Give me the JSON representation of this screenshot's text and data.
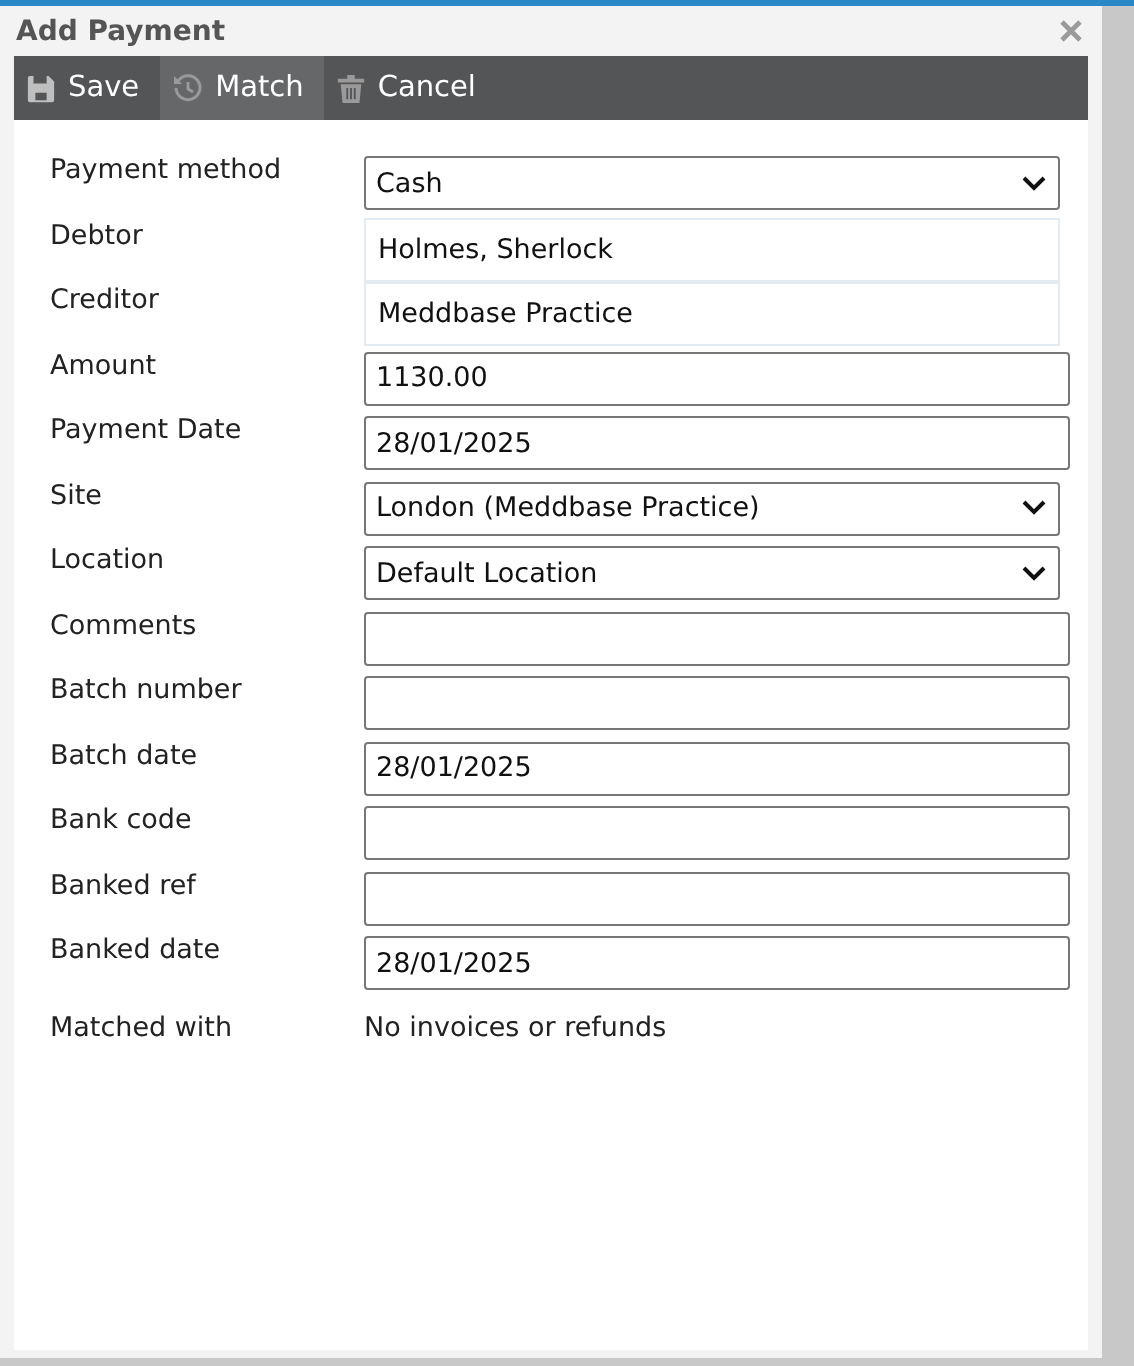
{
  "window": {
    "title": "Add Payment"
  },
  "toolbar": [
    {
      "label": "Save",
      "kind": "save",
      "selected": false
    },
    {
      "label": "Match",
      "kind": "history",
      "selected": true
    },
    {
      "label": "Cancel",
      "kind": "trash",
      "selected": false
    }
  ],
  "fields": [
    {
      "label": "Payment method",
      "kind": "select",
      "value": "Cash"
    },
    {
      "label": "Debtor",
      "kind": "readonly",
      "value": "Holmes, Sherlock"
    },
    {
      "label": "Creditor",
      "kind": "readonly",
      "value": "Meddbase Practice"
    },
    {
      "label": "Amount",
      "kind": "input",
      "value": "1130.00"
    },
    {
      "label": "Payment Date",
      "kind": "input",
      "value": "28/01/2025"
    },
    {
      "label": "Site",
      "kind": "select",
      "value": "London (Meddbase Practice)"
    },
    {
      "label": "Location",
      "kind": "select",
      "value": "Default Location"
    },
    {
      "label": "Comments",
      "kind": "input"
    },
    {
      "label": "Batch number",
      "kind": "input"
    },
    {
      "label": "Batch date",
      "kind": "input",
      "value": "28/01/2025"
    },
    {
      "label": "Bank code",
      "kind": "input"
    },
    {
      "label": "Banked ref",
      "kind": "input"
    },
    {
      "label": "Banked date",
      "kind": "input",
      "value": "28/01/2025"
    },
    {
      "label": "Matched with",
      "kind": "text",
      "value": "No invoices or refunds"
    }
  ]
}
